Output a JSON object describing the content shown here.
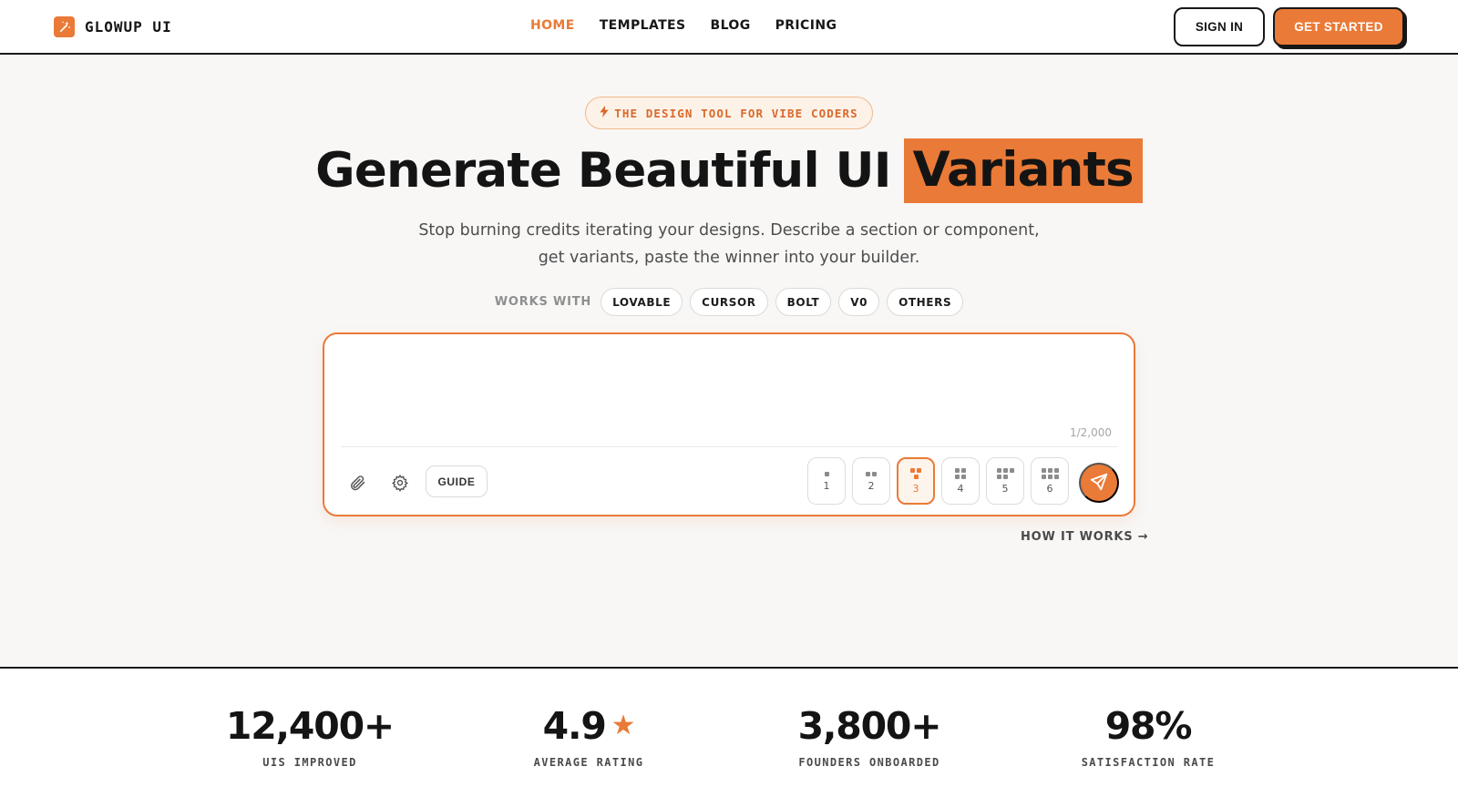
{
  "brand": {
    "name": "GLOWUP UI",
    "logo_icon": "magic-wand-icon"
  },
  "nav": {
    "items": [
      {
        "label": "HOME",
        "active": true
      },
      {
        "label": "TEMPLATES",
        "active": false
      },
      {
        "label": "BLOG",
        "active": false
      },
      {
        "label": "PRICING",
        "active": false
      }
    ]
  },
  "header": {
    "signin_label": "SIGN IN",
    "get_started_label": "GET STARTED"
  },
  "hero": {
    "tag": "THE DESIGN TOOL FOR VIBE CODERS",
    "tag_icon": "lightning-icon",
    "title_main": "Generate Beautiful UI",
    "title_highlight": "Variants",
    "subtitle_line1": "Stop burning credits iterating your designs. Describe a section or component,",
    "subtitle_line2": "get variants, paste the winner into your builder."
  },
  "works_with": {
    "label": "WORKS WITH",
    "chips": [
      "LOVABLE",
      "CURSOR",
      "BOLT",
      "V0",
      "OTHERS"
    ]
  },
  "prompt": {
    "value": "",
    "placeholder": "",
    "counter": "1/2,000",
    "guide_label": "GUIDE",
    "variants": [
      "1",
      "2",
      "3",
      "4",
      "5",
      "6"
    ],
    "selected_variant": "3"
  },
  "how_it_works": "HOW IT WORKS →",
  "stats": [
    {
      "value": "12,400+",
      "label": "UIS IMPROVED"
    },
    {
      "value": "4.9",
      "label": "AVERAGE RATING",
      "icon": "star-icon"
    },
    {
      "value": "3,800+",
      "label": "FOUNDERS ONBOARDED"
    },
    {
      "value": "98%",
      "label": "SATISFACTION RATE"
    }
  ],
  "colors": {
    "accent": "#ea7a37",
    "ink": "#161616",
    "background": "#f8f7f6"
  }
}
